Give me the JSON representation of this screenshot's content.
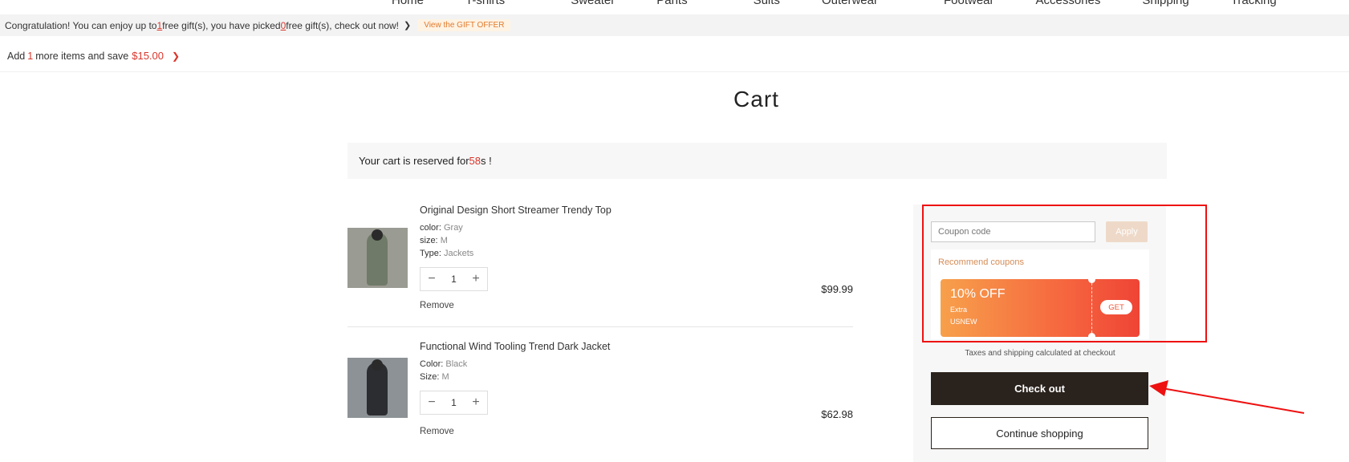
{
  "nav": {
    "items": [
      "Home",
      "T-shirts",
      "Sweater",
      "Pants",
      "Suits",
      "Outerwear",
      "Footwear",
      "Accessories",
      "Shipping",
      "Tracking"
    ]
  },
  "gift_bar": {
    "text_1": "Congratulation! You can enjoy up to ",
    "allowed": "1",
    "text_2": " free gift(s), you have picked ",
    "picked": "0",
    "text_3": " free gift(s), check out now!",
    "offer_label": "View the GIFT OFFER"
  },
  "save_bar": {
    "text_1": "Add",
    "count": "1",
    "text_2": "more items and save",
    "amount": "$15.00"
  },
  "page_title": "Cart",
  "reserve": {
    "text_1": "Your cart is reserved for ",
    "seconds": "58",
    "text_2": "s !"
  },
  "items": [
    {
      "name": "Original Design Short Streamer Trendy Top",
      "attrs": [
        {
          "label": "color:",
          "value": "Gray"
        },
        {
          "label": "size:",
          "value": "M"
        },
        {
          "label": "Type:",
          "value": "Jackets"
        }
      ],
      "qty": "1",
      "remove": "Remove",
      "price": "$99.99"
    },
    {
      "name": "Functional Wind Tooling Trend Dark Jacket",
      "attrs": [
        {
          "label": "Color:",
          "value": "Black"
        },
        {
          "label": "Size:",
          "value": "M"
        }
      ],
      "qty": "1",
      "remove": "Remove",
      "price": "$62.98"
    }
  ],
  "coupon": {
    "placeholder": "Coupon code",
    "apply_label": "Apply",
    "recommend_title": "Recommend coupons",
    "ticket": {
      "percent": "10% OFF",
      "extra": "Extra",
      "code": "USNEW",
      "get_label": "GET"
    }
  },
  "summary": {
    "taxes_note": "Taxes and shipping calculated at checkout",
    "checkout_label": "Check out",
    "continue_label": "Continue shopping"
  },
  "colors": {
    "accent_red": "#d9352b",
    "checkout_bg": "#2a221c",
    "annotation": "#e11111"
  },
  "icons": [
    "minus-icon",
    "plus-icon",
    "chevron-right-icon"
  ]
}
